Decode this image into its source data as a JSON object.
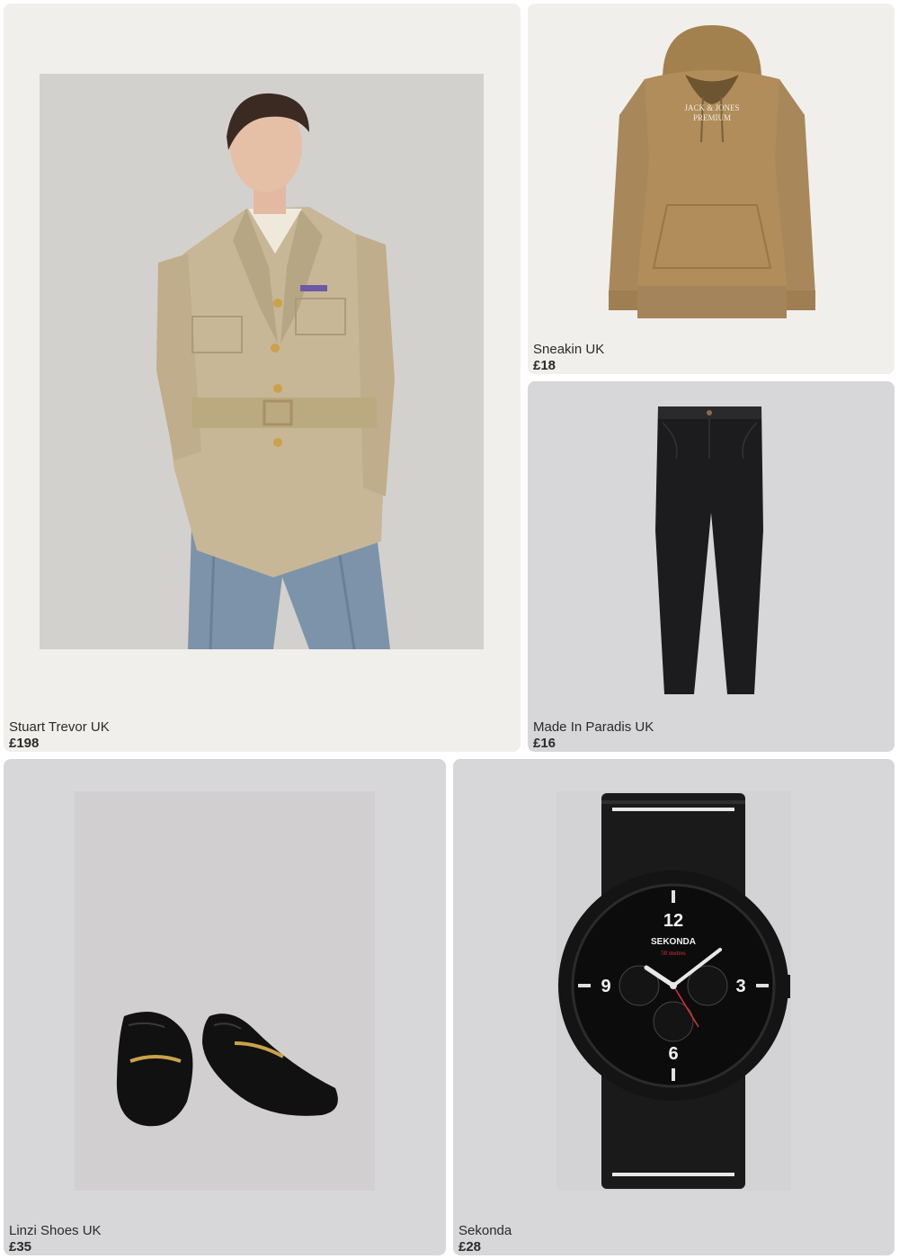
{
  "products": [
    {
      "brand": "Stuart Trevor UK",
      "price": "£198",
      "item": "military-jacket"
    },
    {
      "brand": "Sneakin UK",
      "price": "£18",
      "item": "hoodie",
      "print": [
        "JACK & JONES",
        "PREMIUM"
      ]
    },
    {
      "brand": "Made In Paradis UK",
      "price": "£16",
      "item": "chinos"
    },
    {
      "brand": "Linzi Shoes UK",
      "price": "£35",
      "item": "loafers"
    },
    {
      "brand": "Sekonda",
      "price": "£28",
      "item": "watch",
      "dial": {
        "brand": "SEKONDA",
        "depth": "50 metres",
        "numerals": [
          "12",
          "3",
          "6",
          "9"
        ]
      }
    }
  ],
  "colors": {
    "card_warm": "#f1efeb",
    "card_grey": "#d7d7d9",
    "hoodie": "#b08d5b",
    "jacket": "#c8b796",
    "chinos": "#1c1c1e",
    "watch": "#141414"
  }
}
